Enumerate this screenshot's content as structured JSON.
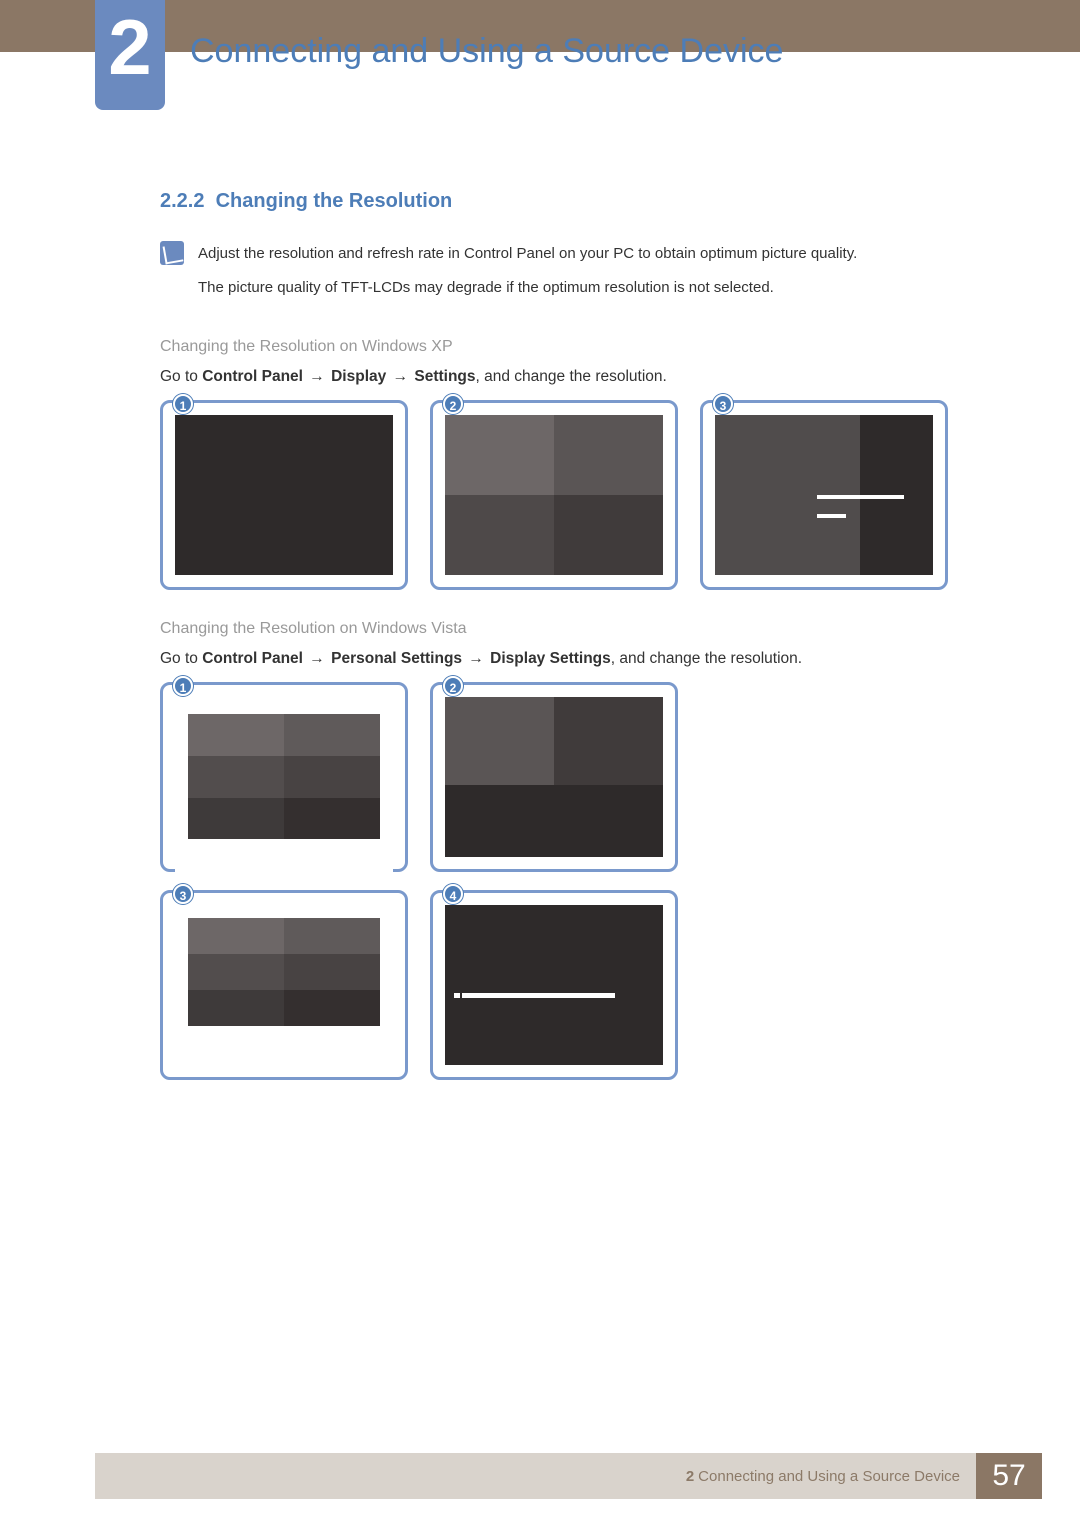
{
  "chapter": {
    "number": "2",
    "title": "Connecting and Using a Source Device"
  },
  "section": {
    "number": "2.2.2",
    "title": "Changing the Resolution"
  },
  "note": {
    "line1": "Adjust the resolution and refresh rate in Control Panel on your PC to obtain optimum picture quality.",
    "line2": "The picture quality of TFT-LCDs may degrade if the optimum resolution is not selected."
  },
  "xp": {
    "subtitle": "Changing the Resolution on Windows XP",
    "instruction_prefix": "Go to ",
    "path_1": "Control Panel",
    "arrow": "→",
    "path_2": "Display",
    "path_3": "Settings",
    "instruction_suffix": ", and change the resolution.",
    "badges": [
      "1",
      "2",
      "3"
    ]
  },
  "vista": {
    "subtitle": "Changing the Resolution on Windows Vista",
    "instruction_prefix": "Go to ",
    "path_1": "Control Panel",
    "arrow": "→",
    "path_2": "Personal Settings",
    "path_3": "Display Settings",
    "instruction_suffix": ", and change the resolution.",
    "badges": [
      "1",
      "2",
      "3",
      "4"
    ]
  },
  "footer": {
    "chapter_num": "2",
    "chapter_title": "Connecting and Using a Source Device",
    "page": "57"
  }
}
